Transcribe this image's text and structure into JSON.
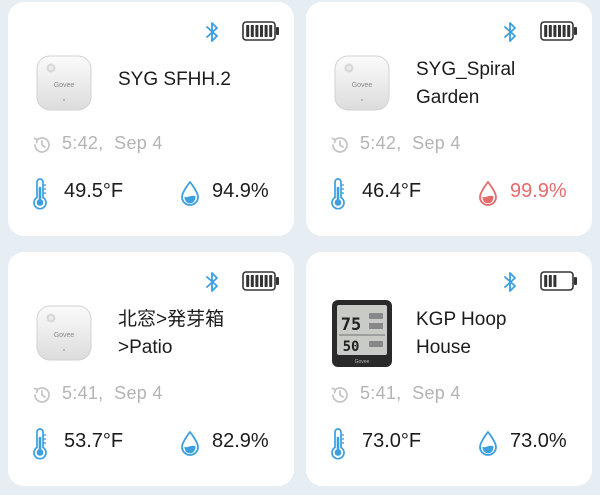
{
  "colors": {
    "accent_blue": "#3b9fe0",
    "alert_red": "#e56b6b",
    "muted_gray": "#b4b4b4",
    "background": "#e6eef4"
  },
  "devices": [
    {
      "name": "SYG SFHH.2",
      "image": "govee-sensor-round",
      "image_label": "Govee",
      "bluetooth_icon": "bluetooth-icon",
      "battery_level": 1.0,
      "last_update": "5:42,  Sep 4",
      "temperature": "49.5°F",
      "humidity": "94.9%",
      "humidity_alert": false
    },
    {
      "name": "SYG_Spiral\nGarden",
      "image": "govee-sensor-round",
      "image_label": "Govee",
      "bluetooth_icon": "bluetooth-icon",
      "battery_level": 1.0,
      "last_update": "5:42,  Sep 4",
      "temperature": "46.4°F",
      "humidity": "99.9%",
      "humidity_alert": true
    },
    {
      "name": "北窓>発芽箱\n>Patio",
      "image": "govee-sensor-round",
      "image_label": "Govee",
      "bluetooth_icon": "bluetooth-icon",
      "battery_level": 1.0,
      "last_update": "5:41,  Sep 4",
      "temperature": "53.7°F",
      "humidity": "82.9%",
      "humidity_alert": false
    },
    {
      "name": "KGP Hoop\nHouse",
      "image": "govee-display-sensor",
      "display_values": [
        "75",
        "50"
      ],
      "image_label": "Govee",
      "bluetooth_icon": "bluetooth-icon",
      "battery_level": 0.5,
      "last_update": "5:41,  Sep 4",
      "temperature": "73.0°F",
      "humidity": "73.0%",
      "humidity_alert": false
    }
  ]
}
